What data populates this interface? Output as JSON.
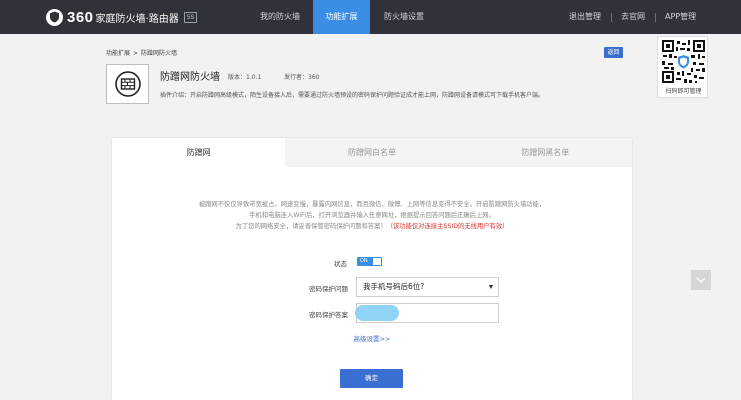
{
  "app": {
    "logo_num": "360",
    "logo_text": "家庭防火墙·路由器",
    "logo_badge": "5S"
  },
  "nav": {
    "items": [
      {
        "label": "我的防火墙"
      },
      {
        "label": "功能扩展"
      },
      {
        "label": "防火墙设置"
      }
    ],
    "active_index": 1,
    "right_links": [
      {
        "label": "退出管理"
      },
      {
        "label": "去官网"
      },
      {
        "label": "APP管理"
      }
    ]
  },
  "breadcrumb": {
    "parent": "功能扩展",
    "separator": ">",
    "current": "防蹭网防火墙"
  },
  "back_button": "返回",
  "plugin": {
    "name": "防蹭网防火墙",
    "version": "版本：1.0.1",
    "publisher": "发行者：360",
    "description": "插件介绍：开启防蹭网高级模式，陌生设备接入后，需要通过防火墙预设的密码保护问题验证成才能上网，防蹭网设备请模式可下载手机客户端。"
  },
  "qr": {
    "caption": "扫码即可管理"
  },
  "tabs": [
    {
      "label": "防蹭网"
    },
    {
      "label": "防蹭网白名单"
    },
    {
      "label": "防蹭网黑名单"
    }
  ],
  "active_tab": 0,
  "intro": {
    "line1": "被蹭网不仅仅导致带宽被占，网速变慢，暴露内网信息，而且微信、微博、上网等信息变得不安全。开启防蹭网防火墙功能，",
    "line2": "手机和电脑连入WiFi后，打开浏览器并输入任意网址，根据提示回答问题后正确后上网。",
    "line3_normal": "为了您的网络安全，请妥善保管密码保护问题和答案！",
    "line3_warning": "（该功能仅对连接主SSID的无线用户有效）"
  },
  "form": {
    "status_label": "状态",
    "toggle_text": "ON",
    "toggle_on": true,
    "question_label": "密码保护问题",
    "question_value": "我手机号码后6位?",
    "answer_label": "密码保护答案",
    "advanced_link": "高级设置>>",
    "confirm_button": "确定"
  },
  "colors": {
    "topbar": "#2f3238",
    "accent": "#3a8ee6",
    "button": "#3a6fd1",
    "warning": "#dd3333"
  }
}
